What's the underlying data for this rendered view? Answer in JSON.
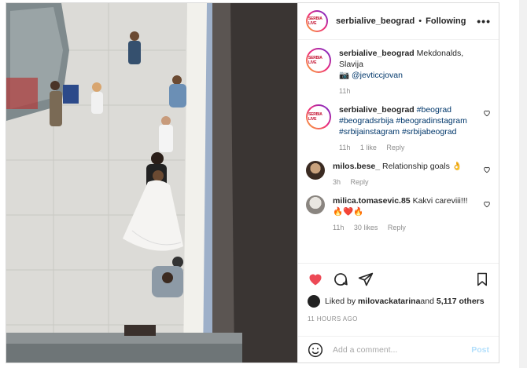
{
  "header": {
    "avatar_text": "SERBIA LIVE",
    "username": "serbialive_beograd",
    "separator": "•",
    "follow_status": "Following",
    "more_icon": "more-icon",
    "more_label": "•••"
  },
  "comments": [
    {
      "username": "serbialive_beograd",
      "text": " Mekdonalds, Slavija",
      "mention_prefix": "📷 ",
      "mention": "@jevticcjovan",
      "time": "11h"
    },
    {
      "username": "serbialive_beograd",
      "text": " #beograd #beogradsrbija #beogradinstagram #srbijainstagram #srbijabeograd",
      "time": "11h",
      "likes": "1 like",
      "reply": "Reply"
    },
    {
      "username": "milos.bese_",
      "text": " Relationship goals 👌",
      "time": "3h",
      "reply": "Reply"
    },
    {
      "username": "milica.tomasevic.85",
      "text": " Kakvi careviii!!! 🔥❤️🔥",
      "time": "11h",
      "likes": "30 likes",
      "reply": "Reply"
    }
  ],
  "actions": {
    "like_color": "#ed4956"
  },
  "likes": {
    "prefix": "Liked by ",
    "user": "milovackatarina",
    "middle": " and ",
    "count": "5,117 others"
  },
  "time_ago": "11 HOURS AGO",
  "add_comment": {
    "placeholder": "Add a comment...",
    "post_label": "Post"
  }
}
